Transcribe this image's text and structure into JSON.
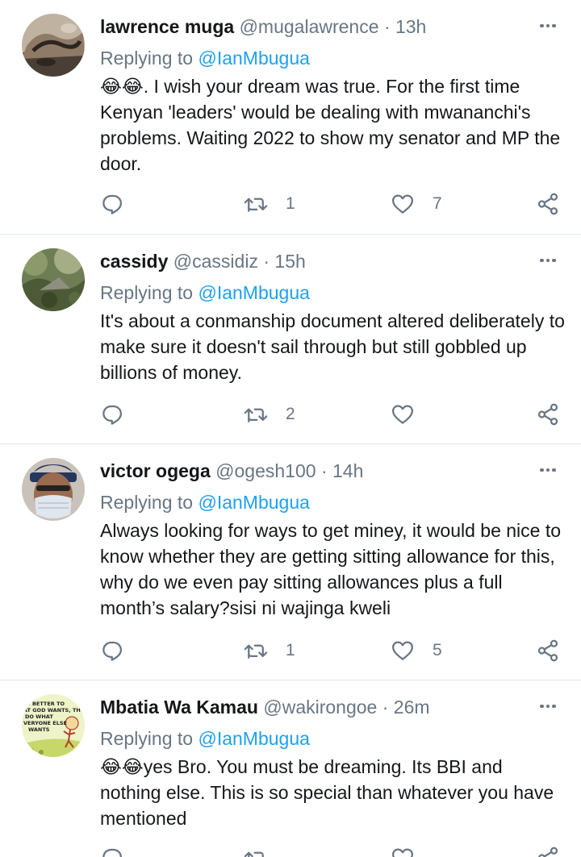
{
  "colors": {
    "link": "#1da1f2",
    "secondary_text": "#687684",
    "divider": "#e1e8ed"
  },
  "tweets": [
    {
      "name": "lawrence muga",
      "handle": "@mugalawrence",
      "separator": "·",
      "time": "13h",
      "replying_prefix": "Replying to",
      "replying_to": "@IanMbugua",
      "text": "😂😂. I wish your dream was true. For the first time Kenyan 'leaders' would be dealing with mwananchi's problems. Waiting 2022 to show my senator and MP the door.",
      "reply_count": "",
      "retweet_count": "1",
      "like_count": "7",
      "avatar_icon": "rock-photo-avatar"
    },
    {
      "name": "cassidy",
      "handle": "@cassidiz",
      "separator": "·",
      "time": "15h",
      "replying_prefix": "Replying to",
      "replying_to": "@IanMbugua",
      "text": "It's about a conmanship document altered deliberately to make sure it doesn't sail through but still gobbled up billions of money.",
      "reply_count": "",
      "retweet_count": "2",
      "like_count": "",
      "avatar_icon": "forest-photo-avatar"
    },
    {
      "name": "victor ogega",
      "handle": "@ogesh100",
      "separator": "·",
      "time": "14h",
      "replying_prefix": "Replying to",
      "replying_to": "@IanMbugua",
      "text": "Always looking for ways to get miney, it would be nice to know whether they are getting sitting allowance for this, why do we even pay sitting allowances plus a full month’s salary?sisi ni wajinga kweli",
      "reply_count": "",
      "retweet_count": "1",
      "like_count": "5",
      "avatar_icon": "masked-person-avatar"
    },
    {
      "name": "Mbatia Wa Kamau",
      "handle": "@wakirongoe",
      "separator": "·",
      "time": "26m",
      "replying_prefix": "Replying to",
      "replying_to": "@IanMbugua",
      "text": "😂😂yes Bro. You must be dreaming. Its BBI and nothing else. This is so special than whatever you have mentioned",
      "reply_count": "",
      "retweet_count": "",
      "like_count": "",
      "avatar_icon": "cartoon-avatar",
      "avatar_text": [
        "S BETTER TO",
        "AT GOD WANTS, TH",
        "DO WHAT",
        "VERYONE ELSE",
        "WANTS"
      ]
    }
  ]
}
